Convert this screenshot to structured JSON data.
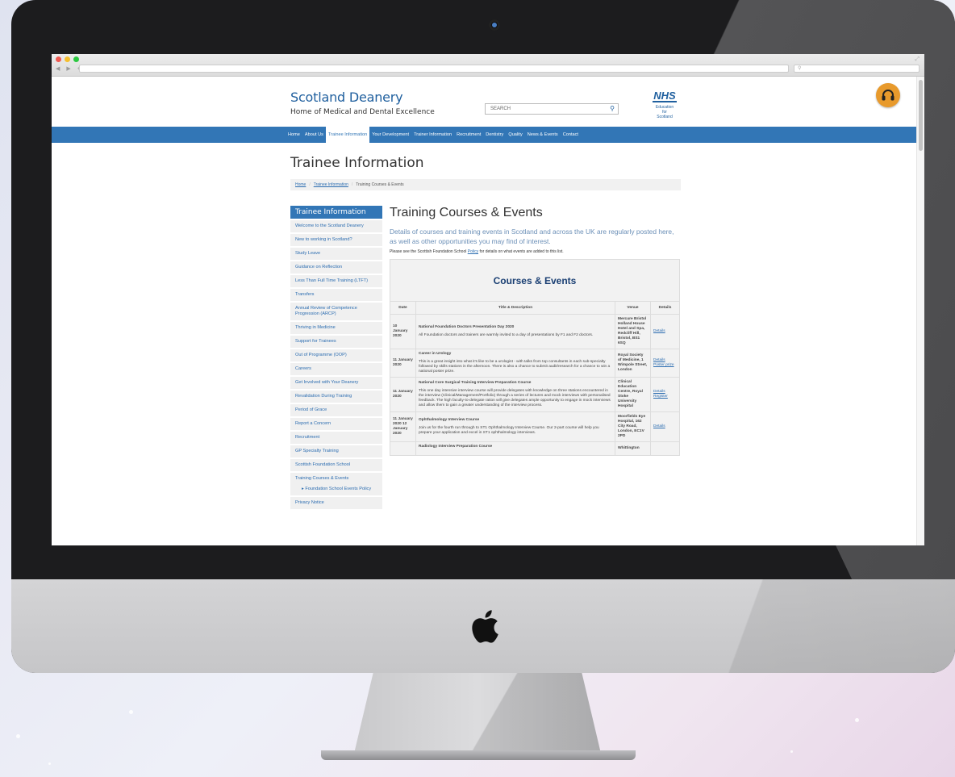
{
  "browser": {
    "url": "",
    "search": ""
  },
  "site": {
    "title": "Scotland Deanery",
    "tagline": "Home of Medical and Dental Excellence",
    "search_label": "SEARCH",
    "nhs_logo": "NHS",
    "nhs_sub": [
      "Education",
      "for",
      "Scotland"
    ]
  },
  "nav": [
    {
      "label": "Home",
      "active": false
    },
    {
      "label": "About Us",
      "active": false
    },
    {
      "label": "Trainee Information",
      "active": true
    },
    {
      "label": "Your Development",
      "active": false
    },
    {
      "label": "Trainer Information",
      "active": false
    },
    {
      "label": "Recruitment",
      "active": false
    },
    {
      "label": "Dentistry",
      "active": false
    },
    {
      "label": "Quality",
      "active": false
    },
    {
      "label": "News & Events",
      "active": false
    },
    {
      "label": "Contact",
      "active": false
    }
  ],
  "page_title": "Trainee Information",
  "breadcrumb": [
    "Home",
    "Trainee Information",
    "Training Courses & Events"
  ],
  "sidebar": {
    "heading": "Trainee Information",
    "items": [
      "Welcome to the Scotland Deanery",
      "New to working in Scotland?",
      "Study Leave",
      "Guidance on Reflection",
      "Less Than Full Time Training (LTFT)",
      "Transfers",
      "Annual Review of Competence Progression (ARCP)",
      "Thriving in Medicine",
      "Support for Trainees",
      "Out of Programme (OOP)",
      "Careers",
      "Get Involved with Your Deanery",
      "Revalidation During Training",
      "Period of Grace",
      "Report a Concern",
      "Recruitment",
      "GP Specialty Training",
      "Scottish Foundation School",
      "Training Courses & Events"
    ],
    "subitem": "Foundation School Events Policy",
    "last_item": "Privacy Notice"
  },
  "content": {
    "title": "Training Courses & Events",
    "lead": "Details of courses and training events in Scotland and across the UK are regularly posted here, as well as other opportunities you may find of interest.",
    "note_before": "Please see the Scottish Foundation School",
    "note_link": "Policy",
    "note_after": "for details on what events are added to this list.",
    "table_caption": "Courses & Events",
    "headers": [
      "Date",
      "Title & Description",
      "Venue",
      "Details"
    ],
    "rows": [
      {
        "date": "10 January 2020",
        "title": "National Foundation Doctors Presentation Day 2020",
        "desc": "All Foundation doctors and trainers are warmly invited to a day of presentations by F1 and F2 doctors.",
        "venue": "Mercure Bristol Holland House Hotel and Spa, Redcliff Hill, Bristol, BS1 6SQ",
        "links": [
          "Details"
        ]
      },
      {
        "date": "11 January 2020",
        "title": "Career in Urology",
        "desc": "This is a great insight into what it's like to be a urologist - with talks from top consultants in each sub-specialty followed by skills stations in the afternoon. There is also a chance to submit audit/research for a chance to win a national poster prize.",
        "venue": "Royal Society of Medicine, 1 Wimpole Street, London",
        "links": [
          "Details",
          "Poster prize"
        ]
      },
      {
        "date": "11 January 2020",
        "title": "National Core Surgical Training Interview Preparation Course",
        "desc": "This one day intensive interview course will provide delegates with knowledge on three stations encountered in the interview (Clinical/Management/Portfolio) through a series of lectures and mock interviews with personalised feedback. The high faculty-to-delegate ration will give delegates ample opportunity to engage in mock interviews and allow them to gain a greater understanding of the interview process.",
        "venue": "Clinical Education Centre, Royal Stoke University Hospital",
        "links": [
          "Details",
          "Register"
        ]
      },
      {
        "date": "11 January 2020 12 January 2020",
        "title": "Ophthalmology Interview Course",
        "desc": "Join us for the fourth run through to ST1 Ophthalmology Interview Course. Our 2-part course will help you prepare your application and excel in ST1 ophthalmology interviews.",
        "venue": "Moorfields Eye Hospital, 162 City Road, London, EC1V 2PD",
        "links": [
          "Details"
        ]
      },
      {
        "date": "",
        "title": "Radiology Interview Preparation Course",
        "desc": "",
        "venue": "Whittington",
        "links": []
      }
    ]
  },
  "colors": {
    "brand_blue": "#3276b6",
    "heading_blue": "#1f5f9e",
    "help_button": "#e89a2c"
  }
}
